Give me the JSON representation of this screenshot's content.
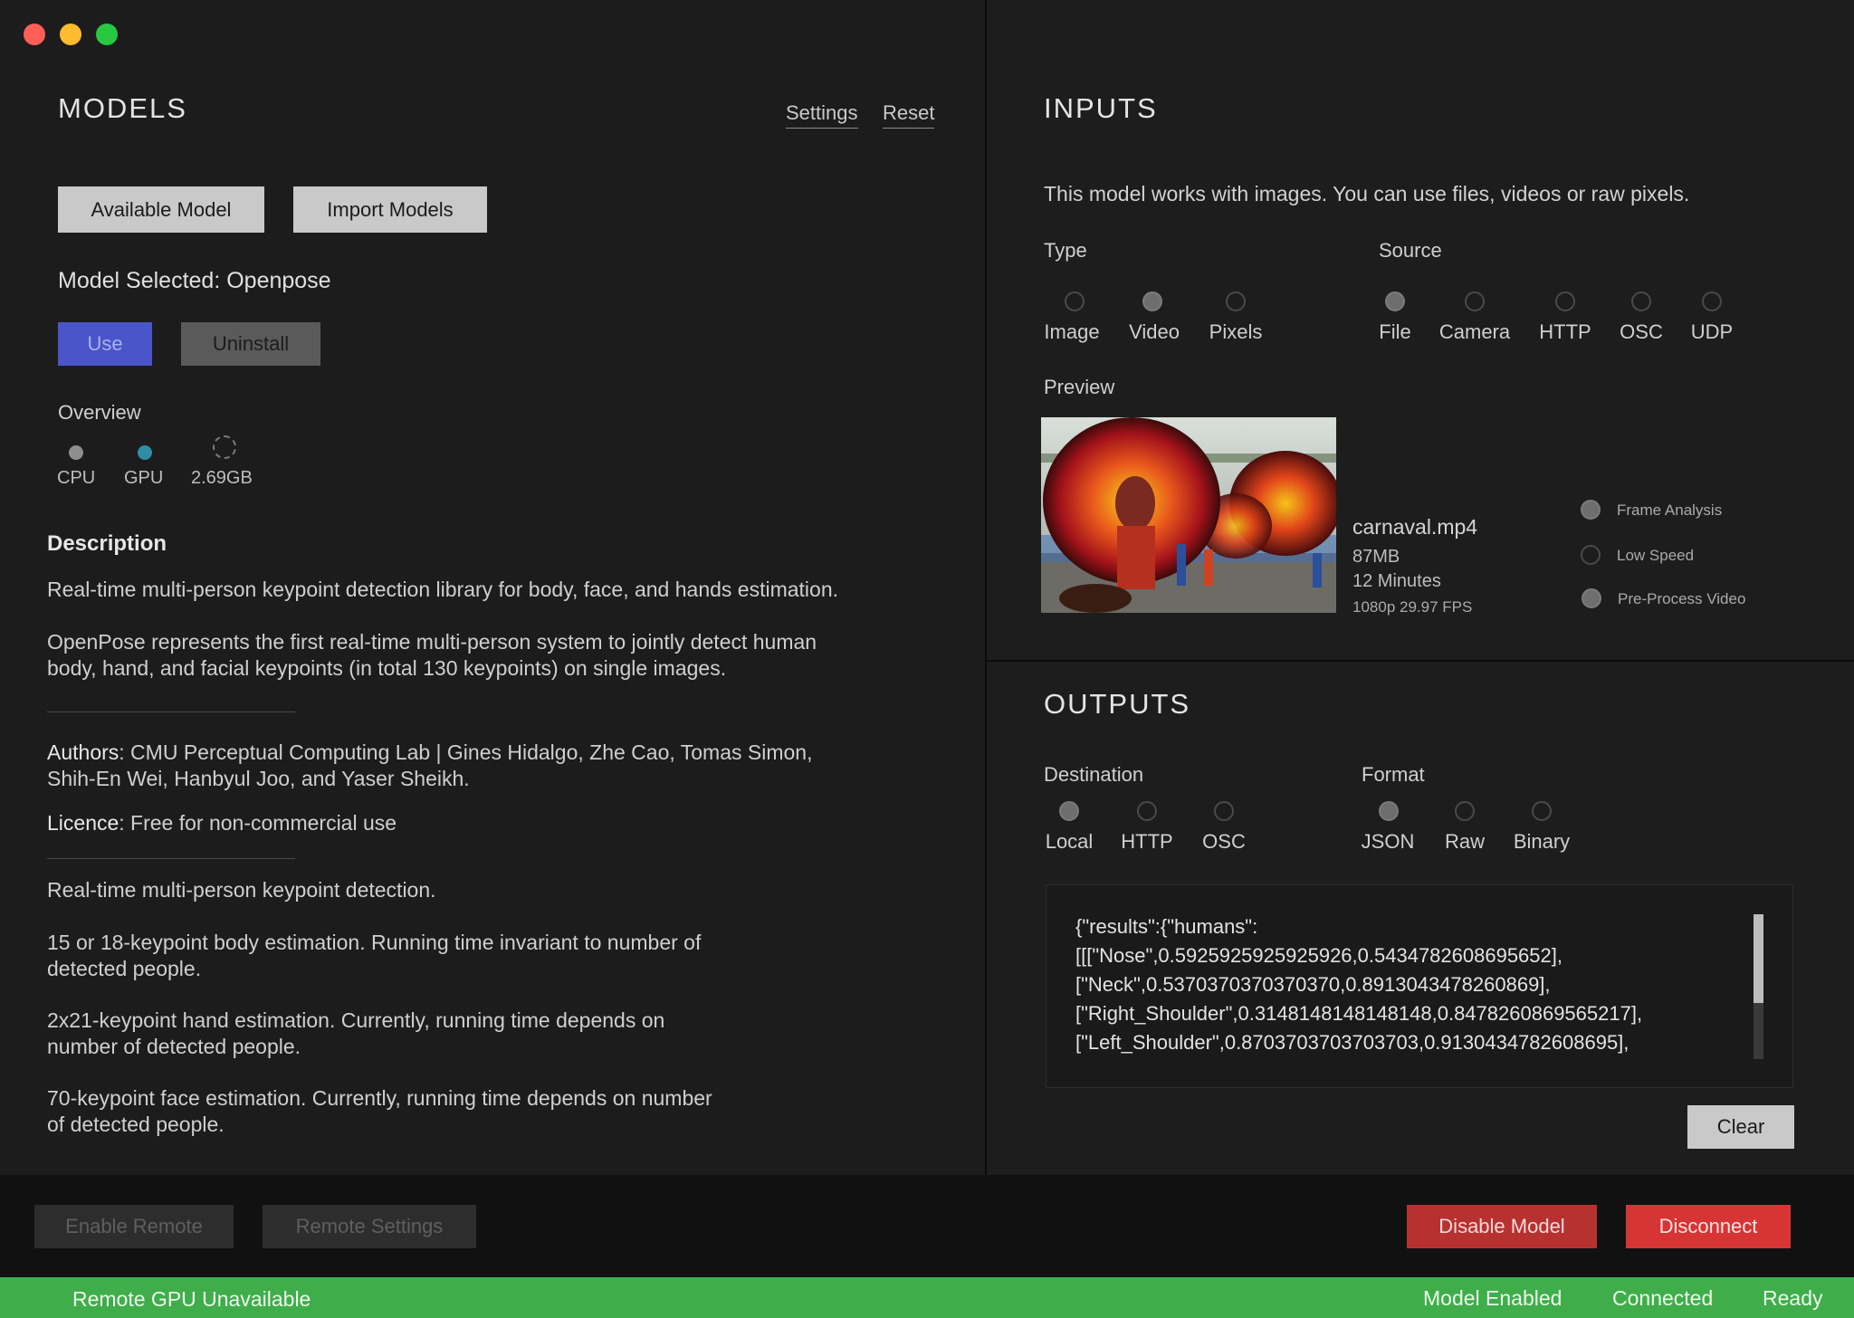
{
  "window": {
    "traffic_lights": {
      "close": "#fd5f57",
      "minimize": "#febc2e",
      "zoom": "#28c840"
    }
  },
  "models": {
    "title": "MODELS",
    "links": {
      "settings": "Settings",
      "reset": "Reset"
    },
    "buttons": {
      "available": "Available Model",
      "import": "Import Models",
      "use": "Use",
      "uninstall": "Uninstall"
    },
    "selected": "Model Selected: Openpose",
    "overview": {
      "label": "Overview",
      "items": [
        {
          "label": "CPU",
          "icon": "cpu-dot-icon",
          "color": "#8e8e8e"
        },
        {
          "label": "GPU",
          "icon": "gpu-dot-icon",
          "color": "#2f8ea1"
        },
        {
          "label": "2.69GB",
          "icon": "storage-ring-icon",
          "color": "#8e8e8e"
        }
      ]
    },
    "description": {
      "heading": "Description",
      "p1": "Real-time multi-person keypoint detection library for body, face, and hands estimation.",
      "p2a": "OpenPose represents the first real-time multi-person system to jointly detect human",
      "p2b": "body, hand, and facial keypoints (in total 130 keypoints) on single images.",
      "authors_label": "Authors",
      "authors_a": ": CMU Perceptual Computing Lab |  Gines Hidalgo, Zhe Cao, Tomas Simon,",
      "authors_b": "Shih-En Wei, Hanbyul Joo, and Yaser Sheikh.",
      "licence_label": "Licence",
      "licence_value": ": Free for non-commercial use",
      "f1": "Real-time multi-person keypoint detection.",
      "f2a": "15 or 18-keypoint body estimation. Running time invariant to number of",
      "f2b": "detected people.",
      "f3a": "2x21-keypoint hand estimation. Currently, running time depends on",
      "f3b": "number of detected people.",
      "f4a": "70-keypoint face estimation. Currently, running time depends on number",
      "f4b": "of detected people."
    }
  },
  "inputs": {
    "title": "INPUTS",
    "intro": "This model works with images. You can use files, videos or raw pixels.",
    "type": {
      "label": "Type",
      "options": [
        "Image",
        "Video",
        "Pixels"
      ],
      "selected": "Video"
    },
    "source": {
      "label": "Source",
      "options": [
        "File",
        "Camera",
        "HTTP",
        "OSC",
        "UDP"
      ],
      "selected": "File"
    },
    "preview": {
      "label": "Preview",
      "filename": "carnaval.mp4",
      "size": "87MB",
      "duration": "12 Minutes",
      "format": "1080p 29.97 FPS"
    },
    "options": [
      {
        "label": "Frame Analysis",
        "checked": true
      },
      {
        "label": "Low Speed",
        "checked": false
      },
      {
        "label": "Pre-Process Video",
        "checked": true
      }
    ]
  },
  "outputs": {
    "title": "OUTPUTS",
    "destination": {
      "label": "Destination",
      "options": [
        "Local",
        "HTTP",
        "OSC"
      ],
      "selected": "Local"
    },
    "format": {
      "label": "Format",
      "options": [
        "JSON",
        "Raw",
        "Binary"
      ],
      "selected": "JSON"
    },
    "json_lines": [
      "{\"results\":{\"humans\":",
      "[[[\"Nose\",0.5925925925925926,0.5434782608695652],",
      "[\"Neck\",0.5370370370370370,0.8913043478260869],",
      "[\"Right_Shoulder\",0.3148148148148148,0.8478260869565217],",
      "[\"Left_Shoulder\",0.8703703703703703,0.9130434782608695],"
    ],
    "clear": "Clear"
  },
  "bottom": {
    "enable_remote": "Enable Remote",
    "remote_settings": "Remote Settings",
    "disable_model": "Disable Model",
    "disconnect": "Disconnect"
  },
  "status": {
    "left": "Remote GPU Unavailable",
    "model": "Model Enabled",
    "connection": "Connected",
    "state": "Ready"
  }
}
